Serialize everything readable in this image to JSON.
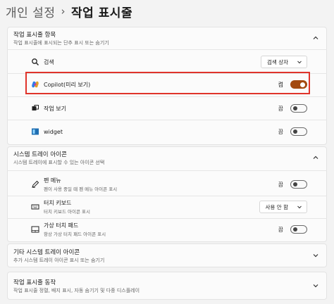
{
  "breadcrumb": {
    "parent": "개인 설정",
    "separator": "›",
    "current": "작업 표시줄"
  },
  "taskbar_items": {
    "title": "작업 표시줄 항목",
    "subtitle": "작업 표시줄에 표시되는 단추 표시 또는 숨기기",
    "search": {
      "label": "검색",
      "value": "검색 상자"
    },
    "copilot": {
      "label": "Copilot(미리 보기)",
      "state": "켬",
      "on": true
    },
    "task_view": {
      "label": "작업 보기",
      "state": "끔",
      "on": false
    },
    "widget": {
      "label": "widget",
      "state": "끔",
      "on": false
    }
  },
  "system_tray": {
    "title": "시스템 트레이 아이콘",
    "subtitle": "시스템 트레이에 표시할 수 있는 아이콘 선택",
    "pen_menu": {
      "label": "펜 메뉴",
      "sub": "펜이 사용 중일 때 펜 메뉴 아이콘 표시",
      "state": "끔",
      "on": false
    },
    "touch_keyboard": {
      "label": "터치 키보드",
      "sub": "터치 키보드 아이콘 표시",
      "value": "사용 안 함"
    },
    "virtual_touchpad": {
      "label": "가상 터치 패드",
      "sub": "항상 가상 터치 패드 아이콘 표시",
      "state": "끔",
      "on": false
    }
  },
  "other_tray": {
    "title": "기타 시스템 트레이 아이콘",
    "subtitle": "추가 시스템 트레이 아이콘 표시 또는 숨기기"
  },
  "behaviors": {
    "title": "작업 표시줄 동작",
    "subtitle": "작업 표시줄 정렬, 배지 표시, 자동 숨기기 및 다중 디스플레이"
  },
  "colors": {
    "accent": "#a34a10",
    "highlight": "#e0342b"
  }
}
